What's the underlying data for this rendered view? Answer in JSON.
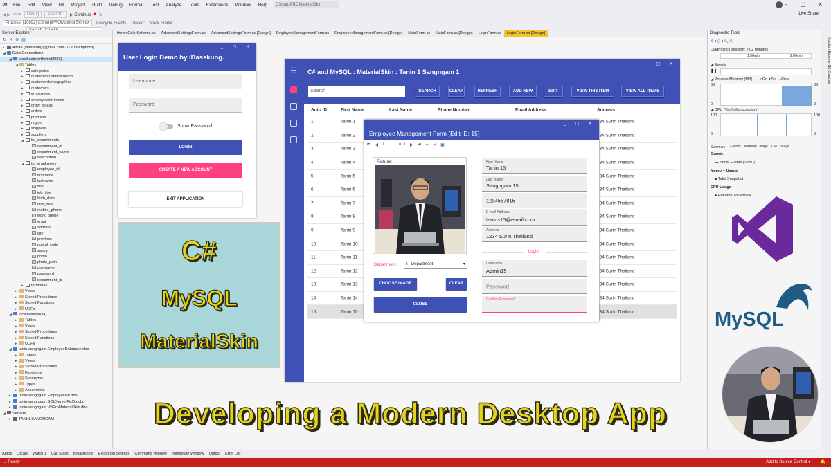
{
  "menu": {
    "items": [
      "File",
      "Edit",
      "View",
      "Git",
      "Project",
      "Build",
      "Debug",
      "Format",
      "Test",
      "Analyze",
      "Tools",
      "Extensions",
      "Window",
      "Help"
    ],
    "search_placeholder": "Search (Ctrl+Q)",
    "solution": "CSharpPROMaterialSkin"
  },
  "toolbar": {
    "config": "Debug",
    "platform": "Any CPU",
    "continue": "Continue",
    "process": "Process: [10892] CSharpPROMaterialSkin.ex",
    "lifecycle": "Lifecycle Events",
    "thread": "Thread:",
    "stack": "Stack Frame:",
    "live_share": "Live Share"
  },
  "tabs": [
    "themeColorScheme.cs",
    "AdvancedSettingsForm.cs",
    "AdvancedSettingsForm.cs [Design]",
    "EmployeeManagementForm.cs",
    "EmployeeManagementForm.cs [Design]",
    "MainForm.cs",
    "MainForm.cs [Design]",
    "LoginForm.cs",
    "LoginForm.cs [Design]"
  ],
  "active_tab": "LoginForm.cs [Design]",
  "server_explorer": {
    "title": "Server Explorer",
    "nodes": [
      {
        "d": 0,
        "t": "Azure (ibasskung@gmail.com - 0 subscriptions)",
        "ic": "srv",
        "a": "▸"
      },
      {
        "d": 0,
        "t": "Data Connections",
        "ic": "db",
        "a": "◢"
      },
      {
        "d": 1,
        "t": "localhost(northwind2022)",
        "ic": "db",
        "a": "◢",
        "sel": true
      },
      {
        "d": 2,
        "t": "Tables",
        "ic": "folder",
        "a": "◢"
      },
      {
        "d": 3,
        "t": "categories",
        "ic": "table",
        "a": "▸"
      },
      {
        "d": 3,
        "t": "customercustomerdemo",
        "ic": "table",
        "a": "▸"
      },
      {
        "d": 3,
        "t": "customerdemographics",
        "ic": "table",
        "a": "▸"
      },
      {
        "d": 3,
        "t": "customers",
        "ic": "table",
        "a": "▸"
      },
      {
        "d": 3,
        "t": "employees",
        "ic": "table",
        "a": "▸"
      },
      {
        "d": 3,
        "t": "employeeterritories",
        "ic": "table",
        "a": "▸"
      },
      {
        "d": 3,
        "t": "order details",
        "ic": "table",
        "a": "▸"
      },
      {
        "d": 3,
        "t": "orders",
        "ic": "table",
        "a": "▸"
      },
      {
        "d": 3,
        "t": "products",
        "ic": "table",
        "a": "▸"
      },
      {
        "d": 3,
        "t": "region",
        "ic": "table",
        "a": "▸"
      },
      {
        "d": 3,
        "t": "shippers",
        "ic": "table",
        "a": "▸"
      },
      {
        "d": 3,
        "t": "suppliers",
        "ic": "table",
        "a": "▸"
      },
      {
        "d": 3,
        "t": "tbl_departments",
        "ic": "table",
        "a": "◢"
      },
      {
        "d": 4,
        "t": "department_id",
        "ic": "col",
        "a": ""
      },
      {
        "d": 4,
        "t": "department_name",
        "ic": "col",
        "a": ""
      },
      {
        "d": 4,
        "t": "description",
        "ic": "col",
        "a": ""
      },
      {
        "d": 3,
        "t": "tbl_employees",
        "ic": "table",
        "a": "◢"
      },
      {
        "d": 4,
        "t": "employee_id",
        "ic": "col",
        "a": ""
      },
      {
        "d": 4,
        "t": "firstname",
        "ic": "col",
        "a": ""
      },
      {
        "d": 4,
        "t": "lastname",
        "ic": "col",
        "a": ""
      },
      {
        "d": 4,
        "t": "title",
        "ic": "col",
        "a": ""
      },
      {
        "d": 4,
        "t": "job_title",
        "ic": "col",
        "a": ""
      },
      {
        "d": 4,
        "t": "birth_date",
        "ic": "col",
        "a": ""
      },
      {
        "d": 4,
        "t": "hire_date",
        "ic": "col",
        "a": ""
      },
      {
        "d": 4,
        "t": "mobile_phone",
        "ic": "col",
        "a": ""
      },
      {
        "d": 4,
        "t": "work_phone",
        "ic": "col",
        "a": ""
      },
      {
        "d": 4,
        "t": "email",
        "ic": "col",
        "a": ""
      },
      {
        "d": 4,
        "t": "address",
        "ic": "col",
        "a": ""
      },
      {
        "d": 4,
        "t": "city",
        "ic": "col",
        "a": ""
      },
      {
        "d": 4,
        "t": "province",
        "ic": "col",
        "a": ""
      },
      {
        "d": 4,
        "t": "postal_code",
        "ic": "col",
        "a": ""
      },
      {
        "d": 4,
        "t": "salary",
        "ic": "col",
        "a": ""
      },
      {
        "d": 4,
        "t": "photo",
        "ic": "col",
        "a": ""
      },
      {
        "d": 4,
        "t": "photo_path",
        "ic": "col",
        "a": ""
      },
      {
        "d": 4,
        "t": "username",
        "ic": "col",
        "a": ""
      },
      {
        "d": 4,
        "t": "password",
        "ic": "col",
        "a": ""
      },
      {
        "d": 4,
        "t": "department_id",
        "ic": "col",
        "a": ""
      },
      {
        "d": 3,
        "t": "territories",
        "ic": "table",
        "a": "▸"
      },
      {
        "d": 2,
        "t": "Views",
        "ic": "folder",
        "a": "▸"
      },
      {
        "d": 2,
        "t": "Stored Procedures",
        "ic": "folder",
        "a": "▸"
      },
      {
        "d": 2,
        "t": "Stored Functions",
        "ic": "folder",
        "a": "▸"
      },
      {
        "d": 2,
        "t": "UDFs",
        "ic": "folder",
        "a": "▸"
      },
      {
        "d": 1,
        "t": "localhost(sakila)",
        "ic": "db",
        "a": "◢"
      },
      {
        "d": 2,
        "t": "Tables",
        "ic": "folder",
        "a": "▸"
      },
      {
        "d": 2,
        "t": "Views",
        "ic": "folder",
        "a": "▸"
      },
      {
        "d": 2,
        "t": "Stored Procedures",
        "ic": "folder",
        "a": "▸"
      },
      {
        "d": 2,
        "t": "Stored Functions",
        "ic": "folder",
        "a": "▸"
      },
      {
        "d": 2,
        "t": "UDFs",
        "ic": "folder",
        "a": "▸"
      },
      {
        "d": 1,
        "t": "tanin-sangngam.EmployeeDatabase.dbo",
        "ic": "db",
        "a": "◢"
      },
      {
        "d": 2,
        "t": "Tables",
        "ic": "folder",
        "a": "▸"
      },
      {
        "d": 2,
        "t": "Views",
        "ic": "folder",
        "a": "▸"
      },
      {
        "d": 2,
        "t": "Stored Procedures",
        "ic": "folder",
        "a": "▸"
      },
      {
        "d": 2,
        "t": "Functions",
        "ic": "folder",
        "a": "▸"
      },
      {
        "d": 2,
        "t": "Synonyms",
        "ic": "folder",
        "a": "▸"
      },
      {
        "d": 2,
        "t": "Types",
        "ic": "folder",
        "a": "▸"
      },
      {
        "d": 2,
        "t": "Assemblies",
        "ic": "folder",
        "a": "▸"
      },
      {
        "d": 1,
        "t": "tanin-sangngam.EmployeeDb.dbo",
        "ic": "db",
        "a": "▸"
      },
      {
        "d": 1,
        "t": "tanin-sangngam.SQLServerPicDb.dbo",
        "ic": "db",
        "a": "▸"
      },
      {
        "d": 1,
        "t": "tanin-sangngam.VBProMaterialSkin.dbo",
        "ic": "db",
        "a": "▸"
      },
      {
        "d": 0,
        "t": "Servers",
        "ic": "srv",
        "a": "◢"
      },
      {
        "d": 1,
        "t": "TANIN-SANGNGAM",
        "ic": "srv",
        "a": "▸"
      }
    ]
  },
  "login": {
    "title": "User Login Demo by iBasskung.",
    "username_placeholder": "Username",
    "password_placeholder": "Password",
    "show_password": "Show Password",
    "login_button": "LOGIN",
    "create_button": "CREATE A NEW ACCOUNT",
    "exit_button": "EXIT APPLICATION"
  },
  "lang_box": {
    "line1": "C#",
    "line2": "MySQL",
    "line3": "MaterialSkin"
  },
  "main_form": {
    "title": "C# and MySQL : MaterialSkin : Tanin 1 Sangngam 1",
    "search_placeholder": "Search",
    "buttons": [
      "SEARCH",
      "CLEAR",
      "REFRESH",
      "ADD NEW",
      "EDIT",
      "VIEW THIS ITEM",
      "VIEW ALL ITEMS"
    ],
    "columns": [
      "Auto ID",
      "First Name",
      "Last Name",
      "Phone Number",
      "Email Address",
      "Address"
    ],
    "rows": [
      {
        "id": "1",
        "first": "Tanin 1",
        "addr": "234 Surin Thailand"
      },
      {
        "id": "2",
        "first": "Tanin 2",
        "addr": "234 Surin Thailand"
      },
      {
        "id": "3",
        "first": "Tanin 3",
        "addr": "234 Surin Thailand"
      },
      {
        "id": "4",
        "first": "Tanin 4",
        "addr": "234 Surin Thailand"
      },
      {
        "id": "5",
        "first": "Tanin 5",
        "addr": "234 Surin Thailand"
      },
      {
        "id": "6",
        "first": "Tanin 6",
        "addr": "234 Surin Thailand"
      },
      {
        "id": "7",
        "first": "Tanin 7",
        "addr": "234 Surin Thailand"
      },
      {
        "id": "8",
        "first": "Tanin 8",
        "addr": "234 Surin Thailand"
      },
      {
        "id": "9",
        "first": "Tanin 9",
        "addr": "234 Surin Thailand"
      },
      {
        "id": "10",
        "first": "Tanin 10",
        "addr": "234 Surin Thailand"
      },
      {
        "id": "11",
        "first": "Tanin 11",
        "addr": "234 Surin Thailand"
      },
      {
        "id": "12",
        "first": "Tanin 12",
        "addr": "234 Surin Thailand"
      },
      {
        "id": "13",
        "first": "Tanin 13",
        "addr": "234 Surin Thailand"
      },
      {
        "id": "14",
        "first": "Tanin 14",
        "addr": "234 Surin Thailand"
      },
      {
        "id": "15",
        "first": "Tanin 15",
        "addr": "234 Surin Thailand"
      }
    ],
    "selected_row": "15"
  },
  "edit_form": {
    "title": "Employee Management Form (Edit ID: 15)",
    "nav_pos": "1",
    "nav_total": "of 1",
    "picture_label": "Picture:",
    "first_name_label": "First Name",
    "first_name": "Tanin 15",
    "last_name_label": "Last Name",
    "last_name": "Sangngam 15",
    "phone": "1234567815",
    "email_label": "E-mail Address",
    "email": "tanins15@email.com",
    "address_label": "Address",
    "address": "1234 Surin Thailand",
    "login_label": "Login:",
    "department_label": "Department:",
    "department": "IT Department",
    "username_label": "Username",
    "username": "Admin15",
    "password_placeholder": "Password",
    "confirm_label": "Confirm Password",
    "choose_image": "CHOOSE IMAGE",
    "clear": "CLEAR",
    "close": "CLOSE"
  },
  "diagnostics": {
    "title": "Diagnostic Tools",
    "session": "Diagnostics session: 2:02 minutes",
    "t1": "1:50min",
    "t2": "2:00min",
    "events": "Events",
    "process_memory": "Process Memory (MB)",
    "legend": [
      "Gc",
      "Sn...",
      "Priva..."
    ],
    "mem_max": "83",
    "mem_min": "0",
    "cpu": "CPU (% of all processors)",
    "cpu_max": "100",
    "cpu_min": "0",
    "tabs": [
      "Summary",
      "Events",
      "Memory Usage",
      "CPU Usage"
    ],
    "events_hdr": "Events",
    "show_events": "Show Events (0 of 0)",
    "memory_usage": "Memory Usage",
    "take_snapshot": "Take Snapshot",
    "cpu_usage": "CPU Usage",
    "record_cpu": "Record CPU Profile",
    "mysql_logo": "MySQL"
  },
  "right_strip": "Solution Explorer   Git Changes",
  "bottom_tabs": [
    "Autos",
    "Locals",
    "Watch 1",
    "Call Stack",
    "Breakpoints",
    "Exception Settings",
    "Command Window",
    "Immediate Window",
    "Output",
    "Error List"
  ],
  "status": {
    "ready": "Ready",
    "source_control": "Add to Source Control ▾"
  },
  "headline": "Developing a Modern Desktop App",
  "colors": {
    "primary": "#3f51b5",
    "accent": "#ff4081",
    "status_bar": "#c51c1c",
    "active_tab": "#f4c430",
    "headline": "#e6d21e"
  }
}
